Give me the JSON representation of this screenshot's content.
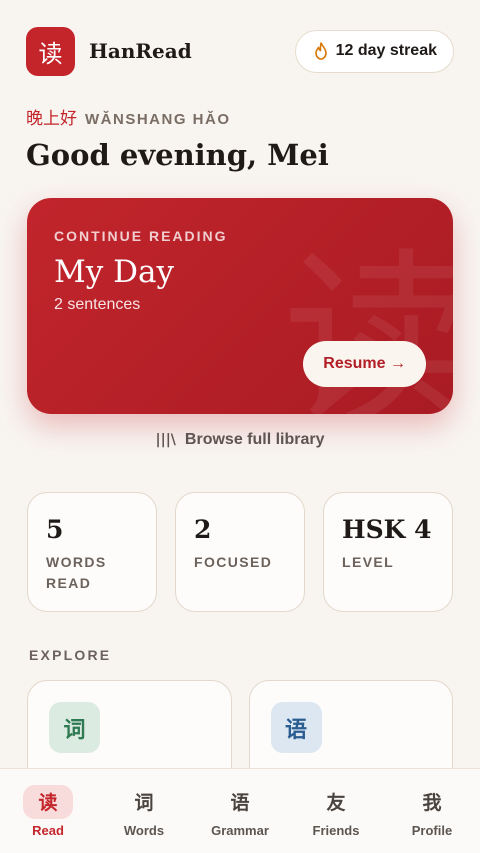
{
  "header": {
    "logo_char": "读",
    "app_name": "HanRead",
    "streak_label": "12 day streak",
    "streak_icon": "flame-icon"
  },
  "greeting": {
    "chinese": "晚上好",
    "pinyin": "WǍNSHANG HǍO",
    "text": "Good evening, Mei"
  },
  "continue_card": {
    "kicker": "CONTINUE READING",
    "title": "My Day",
    "subtitle": "2 sentences",
    "watermark_char": "读",
    "resume_label": "Resume →",
    "accent_color": "#c3252b"
  },
  "browse": {
    "icon": "library-icon",
    "label": "Browse full library"
  },
  "stats": [
    {
      "value": "5",
      "label": "WORDS READ"
    },
    {
      "value": "2",
      "label": "FOCUSED"
    },
    {
      "value": "HSK 4",
      "label": "LEVEL"
    }
  ],
  "explore": {
    "title": "EXPLORE",
    "cards": [
      {
        "char": "词",
        "icon_bg": "#dcebe2",
        "icon_color": "#2f7a52"
      },
      {
        "char": "语",
        "icon_bg": "#dce7f2",
        "icon_color": "#2a5d91"
      }
    ]
  },
  "tabs": [
    {
      "char": "读",
      "label": "Read",
      "active": true
    },
    {
      "char": "词",
      "label": "Words",
      "active": false
    },
    {
      "char": "语",
      "label": "Grammar",
      "active": false
    },
    {
      "char": "友",
      "label": "Friends",
      "active": false
    },
    {
      "char": "我",
      "label": "Profile",
      "active": false
    }
  ]
}
